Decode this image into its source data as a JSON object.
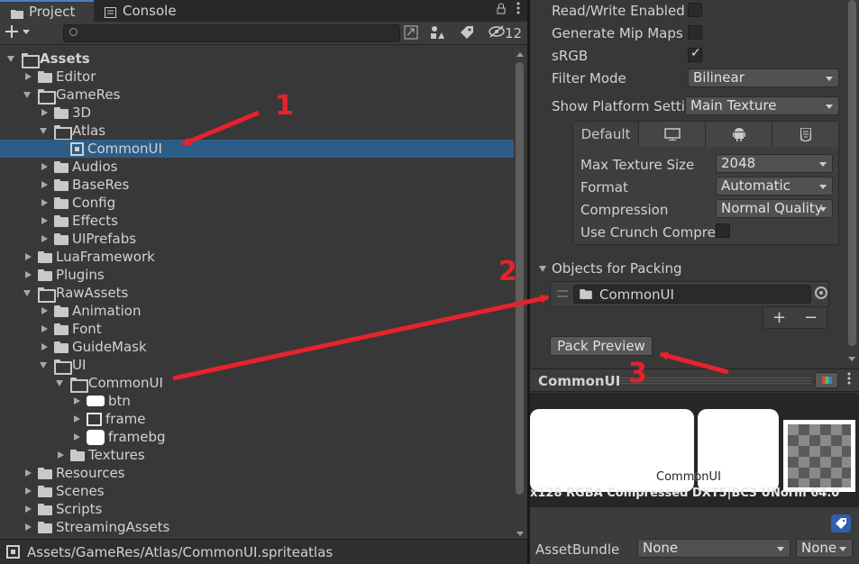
{
  "tabs": {
    "project": "Project",
    "console": "Console"
  },
  "toolbar": {
    "hidden_count": "12"
  },
  "tree": [
    {
      "label": "Assets",
      "arrow": "expanded",
      "icon": "folder-open",
      "bold": true
    },
    {
      "label": "Editor",
      "arrow": "collapsed",
      "icon": "folder"
    },
    {
      "label": "GameRes",
      "arrow": "expanded",
      "icon": "folder-open"
    },
    {
      "label": "3D",
      "arrow": "collapsed",
      "icon": "folder"
    },
    {
      "label": "Atlas",
      "arrow": "expanded",
      "icon": "folder-open"
    },
    {
      "label": "CommonUI",
      "arrow": "none",
      "icon": "atlas",
      "selected": true
    },
    {
      "label": "Audios",
      "arrow": "collapsed",
      "icon": "folder"
    },
    {
      "label": "BaseRes",
      "arrow": "collapsed",
      "icon": "folder"
    },
    {
      "label": "Config",
      "arrow": "collapsed",
      "icon": "folder"
    },
    {
      "label": "Effects",
      "arrow": "collapsed",
      "icon": "folder"
    },
    {
      "label": "UIPrefabs",
      "arrow": "collapsed",
      "icon": "folder"
    },
    {
      "label": "LuaFramework",
      "arrow": "collapsed",
      "icon": "folder"
    },
    {
      "label": "Plugins",
      "arrow": "collapsed",
      "icon": "folder"
    },
    {
      "label": "RawAssets",
      "arrow": "expanded",
      "icon": "folder-open"
    },
    {
      "label": "Animation",
      "arrow": "collapsed",
      "icon": "folder"
    },
    {
      "label": "Font",
      "arrow": "collapsed",
      "icon": "folder"
    },
    {
      "label": "GuideMask",
      "arrow": "collapsed",
      "icon": "folder"
    },
    {
      "label": "UI",
      "arrow": "expanded",
      "icon": "folder-open"
    },
    {
      "label": "CommonUI",
      "arrow": "expanded",
      "icon": "folder-open"
    },
    {
      "label": "btn",
      "arrow": "collapsed",
      "icon": "sprite-white"
    },
    {
      "label": "frame",
      "arrow": "collapsed",
      "icon": "sprite-frame"
    },
    {
      "label": "framebg",
      "arrow": "collapsed",
      "icon": "sprite-framebg"
    },
    {
      "label": "Textures",
      "arrow": "collapsed",
      "icon": "folder"
    },
    {
      "label": "Resources",
      "arrow": "collapsed",
      "icon": "folder"
    },
    {
      "label": "Scenes",
      "arrow": "collapsed",
      "icon": "folder"
    },
    {
      "label": "Scripts",
      "arrow": "collapsed",
      "icon": "folder"
    },
    {
      "label": "StreamingAssets",
      "arrow": "collapsed",
      "icon": "folder"
    }
  ],
  "status": {
    "path": "Assets/GameRes/Atlas/CommonUI.spriteatlas"
  },
  "inspector": {
    "read_write": "Read/Write Enabled",
    "gen_mip": "Generate Mip Maps",
    "srgb": "sRGB",
    "filter_mode": "Filter Mode",
    "filter_mode_value": "Bilinear",
    "show_platform": "Show Platform Setti",
    "show_platform_value": "Main Texture",
    "platform_tab_default": "Default",
    "max_size": "Max Texture Size",
    "max_size_value": "2048",
    "format": "Format",
    "format_value": "Automatic",
    "compression": "Compression",
    "compression_value": "Normal Quality",
    "crunch": "Use Crunch Compres",
    "objects_for_packing": "Objects for Packing",
    "packing_object": "CommonUI",
    "plus": "+",
    "minus": "−",
    "pack_preview": "Pack Preview"
  },
  "preview": {
    "title": "CommonUI",
    "texture_name": "CommonUI",
    "info": "x128 RGBA Compressed DXT5|BC3 UNorm   64.0"
  },
  "asset_bundle": {
    "label": "AssetBundle",
    "name_value": "None",
    "variant_value": "None"
  },
  "annotations": {
    "n1": "1",
    "n2": "2",
    "n3": "3",
    "color": "#e8222c"
  }
}
